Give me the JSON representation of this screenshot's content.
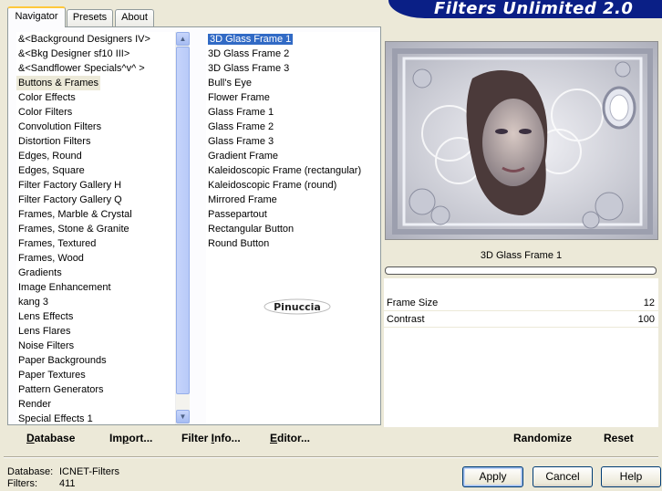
{
  "banner_title": "Filters Unlimited 2.0",
  "tabs": [
    {
      "label": "Navigator",
      "active": true
    },
    {
      "label": "Presets",
      "active": false
    },
    {
      "label": "About",
      "active": false
    }
  ],
  "categories": [
    "&<Background Designers IV>",
    "&<Bkg Designer sf10 III>",
    "&<Sandflower Specials^v^ >",
    "Buttons & Frames",
    "Color Effects",
    "Color Filters",
    "Convolution Filters",
    "Distortion Filters",
    "Edges, Round",
    "Edges, Square",
    "Filter Factory Gallery H",
    "Filter Factory Gallery Q",
    "Frames, Marble & Crystal",
    "Frames, Stone & Granite",
    "Frames, Textured",
    "Frames, Wood",
    "Gradients",
    "Image Enhancement",
    "kang 3",
    "Lens Effects",
    "Lens Flares",
    "Noise Filters",
    "Paper Backgrounds",
    "Paper Textures",
    "Pattern Generators",
    "Render",
    "Special Effects 1"
  ],
  "selected_category": "Buttons & Frames",
  "filters": [
    {
      "label": "3D Glass Frame 1",
      "grip": false
    },
    {
      "label": "3D Glass Frame 2",
      "grip": false
    },
    {
      "label": "3D Glass Frame 3",
      "grip": false
    },
    {
      "label": "Bull's Eye",
      "grip": false
    },
    {
      "label": "Flower Frame",
      "grip": true
    },
    {
      "label": "Glass Frame 1",
      "grip": false
    },
    {
      "label": "Glass Frame 2",
      "grip": false
    },
    {
      "label": "Glass Frame 3",
      "grip": false
    },
    {
      "label": "Gradient Frame",
      "grip": true
    },
    {
      "label": "Kaleidoscopic Frame (rectangular)",
      "grip": false
    },
    {
      "label": "Kaleidoscopic Frame (round)",
      "grip": false
    },
    {
      "label": "Mirrored Frame",
      "grip": false
    },
    {
      "label": "Passepartout",
      "grip": true
    },
    {
      "label": "Rectangular Button",
      "grip": false
    },
    {
      "label": "Round Button",
      "grip": false
    }
  ],
  "selected_filter": "3D Glass Frame 1",
  "watermark": "Pinuccia",
  "bottom_links": {
    "database": "Database",
    "import": "Import...",
    "filter_info": "Filter Info...",
    "editor": "Editor..."
  },
  "preview": {
    "filter_name": "3D Glass Frame 1",
    "params": [
      {
        "label": "Frame Size",
        "value": "12",
        "level": 0.047
      },
      {
        "label": "Contrast",
        "value": "100",
        "level": 0.39
      }
    ]
  },
  "right_buttons": {
    "randomize": "Randomize",
    "reset": "Reset"
  },
  "status": {
    "database_label": "Database:",
    "database_value": "ICNET-Filters",
    "filters_label": "Filters:",
    "filters_value": "411"
  },
  "dialog_buttons": {
    "apply": "Apply",
    "cancel": "Cancel",
    "help": "Help"
  },
  "colors": {
    "banner": "#0a1f86",
    "selection": "#316ac5",
    "dialog_bg": "#ece9d8"
  }
}
